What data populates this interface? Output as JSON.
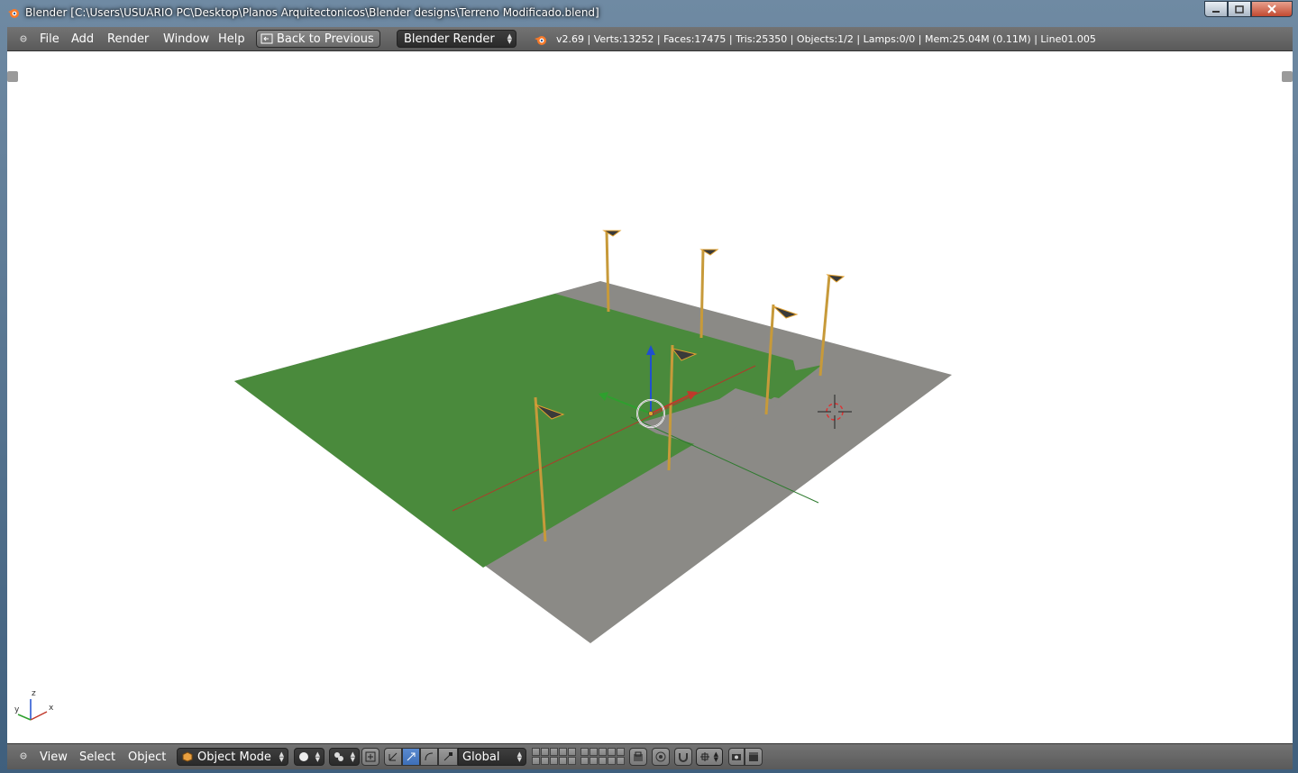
{
  "window": {
    "title": "Blender [C:\\Users\\USUARIO PC\\Desktop\\Planos Arquitectonicos\\Blender designs\\Terreno Modificado.blend]",
    "minimize_icon": "minimize-icon",
    "maximize_icon": "maximize-icon",
    "close_icon": "close-icon"
  },
  "menu": {
    "items": [
      "File",
      "Add",
      "Render",
      "Window",
      "Help"
    ],
    "back_button": "Back to Previous",
    "render_engine": "Blender Render",
    "stats": "v2.69 | Verts:13252 | Faces:17475 | Tris:25350 | Objects:1/2 | Lamps:0/0 | Mem:25.04M (0.11M) | Line01.005"
  },
  "axis_widget": {
    "x": "x",
    "y": "y",
    "z": "z"
  },
  "bottom_toolbar": {
    "menus": [
      "View",
      "Select",
      "Object"
    ],
    "mode": "Object Mode",
    "orientation": "Global"
  },
  "colors": {
    "viewport_bg": "#ffffff",
    "grass": "#4a8a3c",
    "ground": "#8a8a86",
    "pole": "#c08a3a",
    "selection": "#e0a030",
    "x_axis": "#c0392b",
    "y_axis": "#2ea02e",
    "z_axis": "#1f4fd0"
  }
}
